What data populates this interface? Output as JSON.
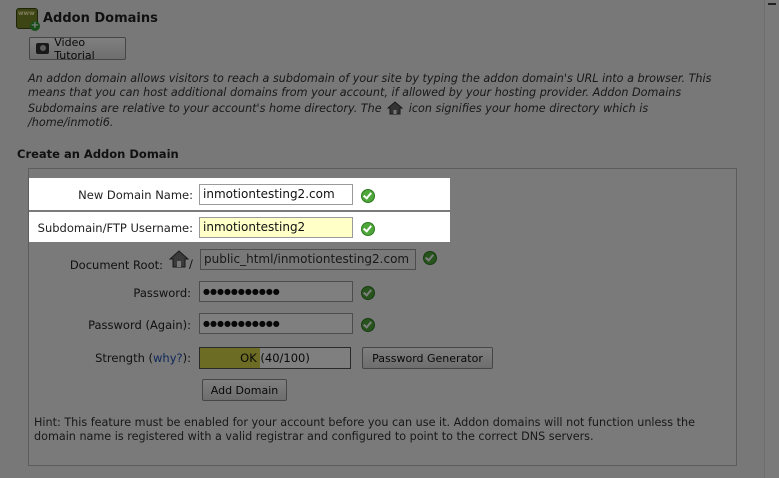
{
  "page": {
    "title": "Addon Domains",
    "video_button": "Video Tutorial",
    "intro_part1": "An addon domain allows visitors to reach a subdomain of your site by typing the addon domain's URL into a browser. This means that you can host additional domains from your account, if allowed by your hosting provider. Addon Domains Subdomains are relative to your account's home directory. The",
    "intro_part2": "icon signifies your home directory which is",
    "home_path": "/home/inmoti6."
  },
  "form": {
    "section_title": "Create an Addon Domain",
    "new_domain": {
      "label": "New Domain Name:",
      "value": "inmotiontesting2.com"
    },
    "subdomain": {
      "label": "Subdomain/FTP Username:",
      "value": "inmotiontesting2"
    },
    "document_root": {
      "label": "Document Root:",
      "prefix": "/",
      "value": "public_html/inmotiontesting2.com"
    },
    "password": {
      "label": "Password:",
      "value": "●●●●●●●●●●●"
    },
    "password_again": {
      "label": "Password (Again):",
      "value": "●●●●●●●●●●●"
    },
    "strength": {
      "label": "Strength (",
      "why": "why?",
      "label_end": "):",
      "text": "OK (40/100)",
      "score": 40,
      "max": 100
    },
    "password_generator": "Password Generator",
    "add_domain": "Add Domain",
    "hint": "Hint: This feature must be enabled for your account before you can use it. Addon domains will not function unless the domain name is registered with a valid registrar and configured to point to the correct DNS servers."
  },
  "colors": {
    "overlay": "#000000",
    "subdomain_field_bg": "#ffffc8",
    "strength_fill": "#d8d84a",
    "check_green": "#4fa63a",
    "link": "#1d4fb0"
  },
  "icons": [
    "addon-domains-icon",
    "video-camera-icon",
    "home-icon",
    "check-icon"
  ]
}
